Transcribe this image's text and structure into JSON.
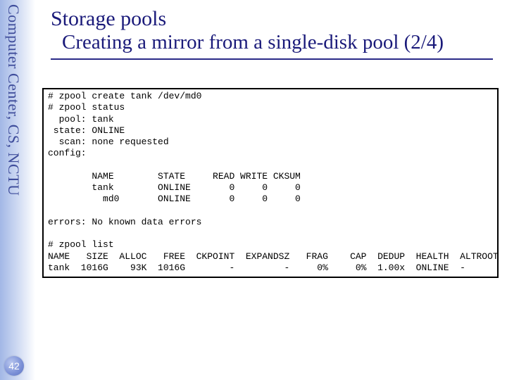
{
  "sidebar": {
    "label": "Computer Center, CS, NCTU"
  },
  "title": {
    "line1": "Storage pools",
    "line2": "Creating a mirror from a single-disk pool (2/4)"
  },
  "terminal": {
    "cmd_create": "# zpool create tank /dev/md0",
    "cmd_status": "# zpool status",
    "pool_line": "  pool: tank",
    "state_line": " state: ONLINE",
    "scan_line": "  scan: none requested",
    "config_line": "config:",
    "hdr_row": "        NAME        STATE     READ WRITE CKSUM",
    "row_tank": "        tank        ONLINE       0     0     0",
    "row_md0": "          md0       ONLINE       0     0     0",
    "errors_line": "errors: No known data errors",
    "cmd_list": "# zpool list",
    "list_hdr": "NAME   SIZE  ALLOC   FREE  CKPOINT  EXPANDSZ   FRAG    CAP  DEDUP  HEALTH  ALTROOT",
    "list_row": "tank  1016G    93K  1016G        -         -     0%     0%  1.00x  ONLINE  -"
  },
  "page": {
    "number": "42"
  }
}
